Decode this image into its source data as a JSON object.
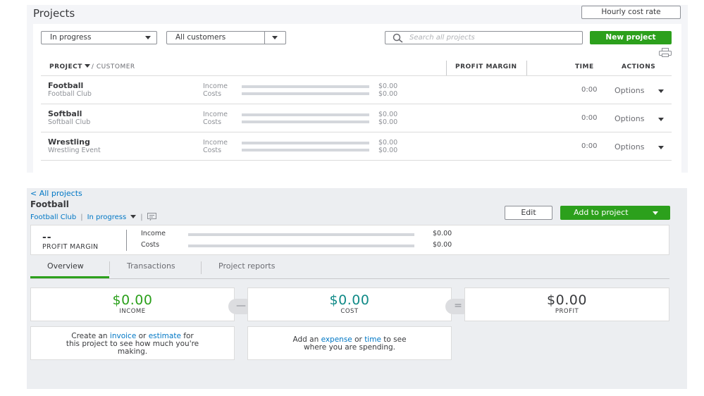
{
  "projects_list": {
    "title": "Projects",
    "hourly_cost_rate_label": "Hourly cost rate",
    "status_filter": "In progress",
    "customer_filter": "All customers",
    "search_placeholder": "Search all projects",
    "new_project_label": "New project",
    "columns": {
      "project": "PROJECT",
      "customer": "/ CUSTOMER",
      "profit_margin": "PROFIT MARGIN",
      "time": "TIME",
      "actions": "ACTIONS"
    },
    "rows": [
      {
        "name": "Football",
        "customer": "Football Club",
        "income_label": "Income",
        "costs_label": "Costs",
        "income": "$0.00",
        "costs": "$0.00",
        "time": "0:00",
        "options_label": "Options"
      },
      {
        "name": "Softball",
        "customer": "Softball Club",
        "income_label": "Income",
        "costs_label": "Costs",
        "income": "$0.00",
        "costs": "$0.00",
        "time": "0:00",
        "options_label": "Options"
      },
      {
        "name": "Wrestling",
        "customer": "Wrestling Event",
        "income_label": "Income",
        "costs_label": "Costs",
        "income": "$0.00",
        "costs": "$0.00",
        "time": "0:00",
        "options_label": "Options"
      }
    ]
  },
  "project_detail": {
    "back_link": "< All projects",
    "title": "Football",
    "customer": "Football Club",
    "status": "In progress",
    "edit_label": "Edit",
    "add_to_project_label": "Add to project",
    "profit_margin_value": "--",
    "profit_margin_label": "PROFIT MARGIN",
    "income_label": "Income",
    "costs_label": "Costs",
    "income_amount": "$0.00",
    "costs_amount": "$0.00",
    "tabs": [
      "Overview",
      "Transactions",
      "Project reports"
    ],
    "active_tab": "Overview",
    "income_value": "$0.00",
    "income_caption": "INCOME",
    "cost_value": "$0.00",
    "cost_caption": "COST",
    "profit_value": "$0.00",
    "profit_caption": "PROFIT",
    "minus_symbol": "—",
    "equals_symbol": "=",
    "income_help": {
      "line1_pre": "Create an ",
      "invoice_link": "invoice",
      "line1_mid": " or ",
      "estimate_link": "estimate",
      "line1_post": " for",
      "line2": "this project to see how much you're",
      "line3": "making."
    },
    "cost_help": {
      "line1_pre": "Add an ",
      "expense_link": "expense",
      "line1_mid": " or ",
      "time_link": "time",
      "line1_post": " to see",
      "line2": "where you are spending."
    }
  },
  "colors": {
    "accent_green": "#2ca01c",
    "link_blue": "#0077c5",
    "income_green": "#2ca01c",
    "cost_teal": "#108a87",
    "text_dark": "#393a3d"
  },
  "icons": [
    "search-icon",
    "print-icon",
    "note-icon",
    "chevron-left-icon",
    "caret-down-icon"
  ]
}
